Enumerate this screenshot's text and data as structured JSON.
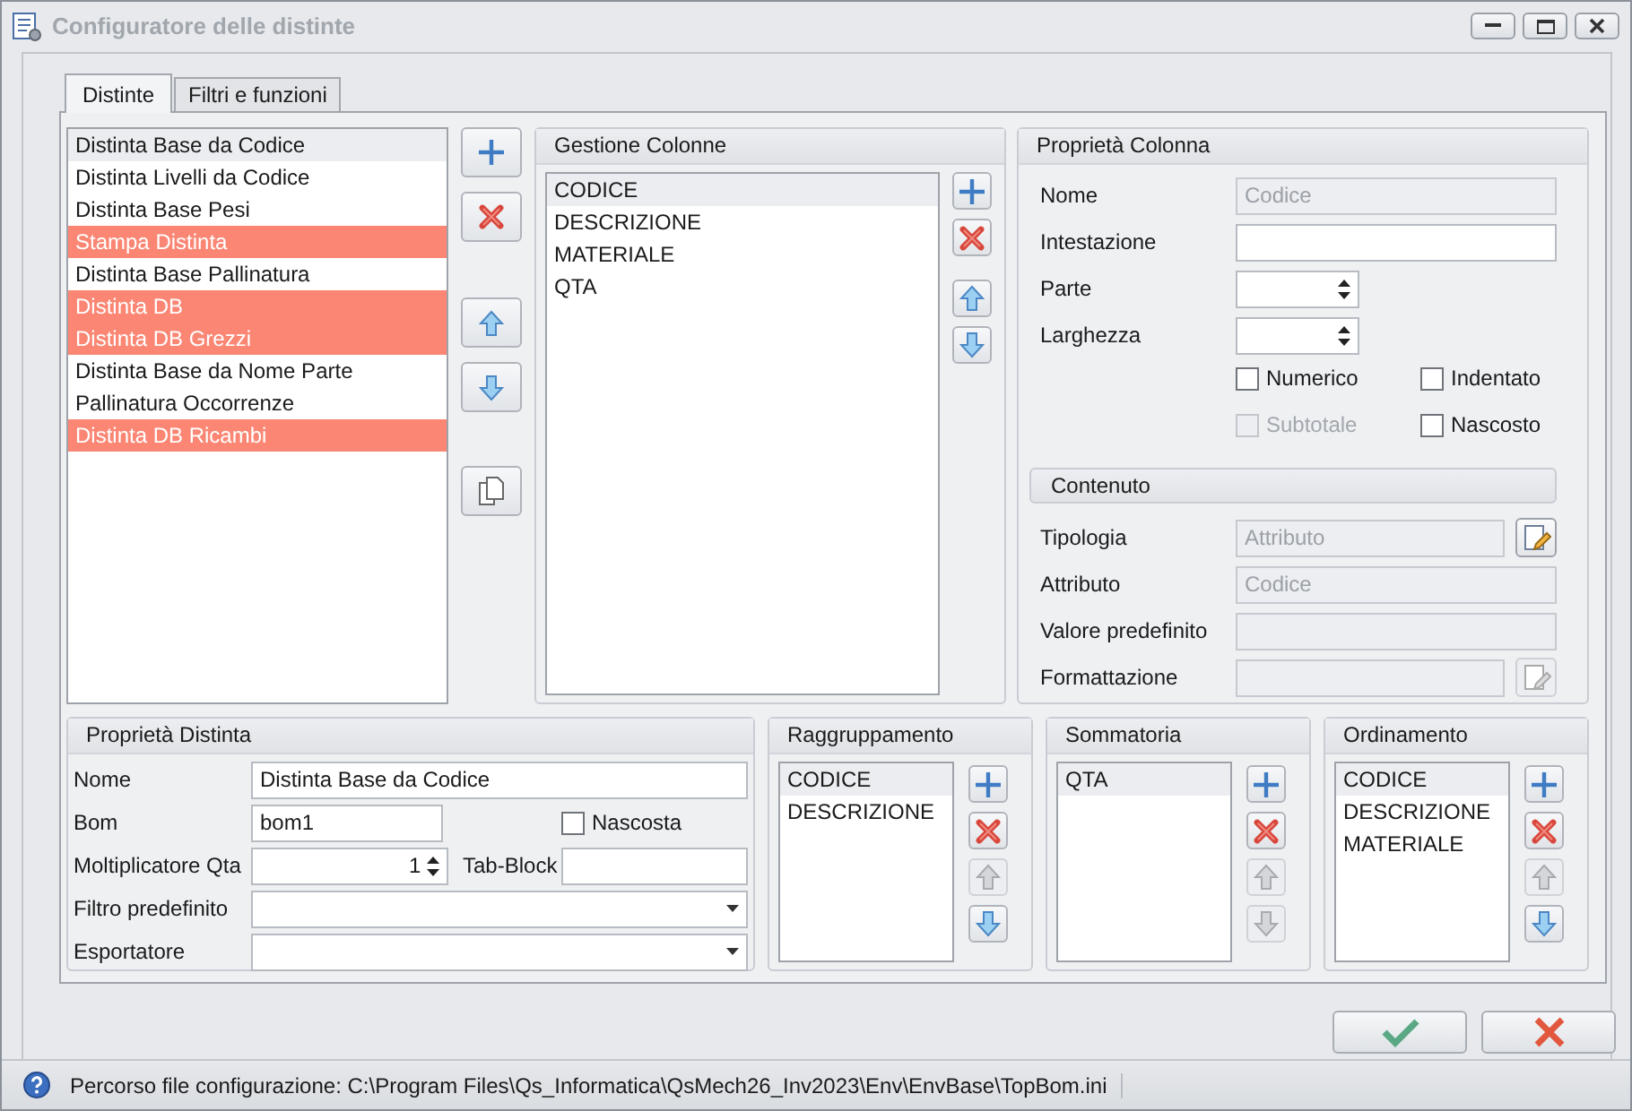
{
  "window": {
    "title": "Configuratore delle distinte"
  },
  "tabs": [
    {
      "label": "Distinte",
      "selected": true
    },
    {
      "label": "Filtri e funzioni",
      "selected": false
    }
  ],
  "distinte": {
    "items": [
      {
        "label": "Distinta Base da Codice",
        "selected": true,
        "highlighted": false
      },
      {
        "label": "Distinta Livelli da Codice",
        "selected": false,
        "highlighted": false
      },
      {
        "label": "Distinta Base Pesi",
        "selected": false,
        "highlighted": false
      },
      {
        "label": "Stampa Distinta",
        "selected": false,
        "highlighted": true
      },
      {
        "label": "Distinta Base Pallinatura",
        "selected": false,
        "highlighted": false
      },
      {
        "label": "Distinta DB",
        "selected": false,
        "highlighted": true
      },
      {
        "label": "Distinta DB Grezzi",
        "selected": false,
        "highlighted": true
      },
      {
        "label": "Distinta Base da Nome Parte",
        "selected": false,
        "highlighted": false
      },
      {
        "label": "Pallinatura Occorrenze",
        "selected": false,
        "highlighted": false
      },
      {
        "label": "Distinta DB Ricambi",
        "selected": false,
        "highlighted": true
      }
    ],
    "buttons": [
      {
        "kind": "add",
        "disabled": false
      },
      {
        "kind": "remove",
        "disabled": false
      },
      {
        "kind": "up",
        "disabled": false
      },
      {
        "kind": "down",
        "disabled": false
      },
      {
        "kind": "copy",
        "disabled": false
      }
    ]
  },
  "gestione_colonne": {
    "title": "Gestione Colonne",
    "items": [
      {
        "label": "CODICE",
        "selected": true
      },
      {
        "label": "DESCRIZIONE",
        "selected": false
      },
      {
        "label": "MATERIALE",
        "selected": false
      },
      {
        "label": "QTA",
        "selected": false
      }
    ],
    "buttons": [
      {
        "kind": "add",
        "disabled": false
      },
      {
        "kind": "remove",
        "disabled": false
      },
      {
        "kind": "up",
        "disabled": false
      },
      {
        "kind": "down",
        "disabled": false
      }
    ]
  },
  "proprieta_colonna": {
    "title": "Proprietà Colonna",
    "fields": [
      {
        "kind": "text",
        "label": "Nome",
        "value": "Codice",
        "disabled": true
      },
      {
        "kind": "text",
        "label": "Intestazione",
        "disabled": false
      },
      {
        "kind": "spin",
        "label": "Parte",
        "disabled": false
      },
      {
        "kind": "spin",
        "label": "Larghezza",
        "disabled": false
      }
    ],
    "checkboxes": [
      {
        "label": "Numerico",
        "checked": false,
        "disabled": false
      },
      {
        "label": "Indentato",
        "checked": false,
        "disabled": false
      },
      {
        "label": "Subtotale",
        "checked": false,
        "disabled": true
      },
      {
        "label": "Nascosto",
        "checked": false,
        "disabled": false
      }
    ],
    "contenuto": {
      "title": "Contenuto",
      "fields": [
        {
          "kind": "edit",
          "label": "Tipologia",
          "value": "Attributo",
          "disabled": true,
          "button_disabled": false
        },
        {
          "kind": "text",
          "label": "Attributo",
          "value": "Codice",
          "disabled": true
        },
        {
          "kind": "text",
          "label": "Valore predefinito",
          "disabled": true
        },
        {
          "kind": "edit",
          "label": "Formattazione",
          "disabled": true,
          "button_disabled": true
        }
      ]
    }
  },
  "proprieta_distinta": {
    "title": "Proprietà Distinta",
    "rows": [
      [
        {
          "kind": "text",
          "label": "Nome",
          "value": "Distinta Base da Codice"
        }
      ],
      [
        {
          "kind": "text",
          "label": "Bom",
          "value": "bom1"
        },
        {
          "kind": "checkbox",
          "label": "Nascosta",
          "checked": false
        }
      ],
      [
        {
          "kind": "spin",
          "label": "Moltiplicatore Qta",
          "value": "1"
        },
        {
          "kind": "text",
          "label": "Tab-Block"
        }
      ],
      [
        {
          "kind": "dropdown",
          "label": "Filtro predefinito"
        }
      ],
      [
        {
          "kind": "dropdown",
          "label": "Esportatore"
        }
      ]
    ]
  },
  "groups": [
    {
      "title": "Raggruppamento",
      "items": [
        {
          "label": "CODICE",
          "selected": true
        },
        {
          "label": "DESCRIZIONE",
          "selected": false
        }
      ],
      "buttons": [
        {
          "kind": "add",
          "disabled": false
        },
        {
          "kind": "remove",
          "disabled": false
        },
        {
          "kind": "up",
          "disabled": true
        },
        {
          "kind": "down",
          "disabled": false
        }
      ]
    },
    {
      "title": "Sommatoria",
      "items": [
        {
          "label": "QTA",
          "selected": true
        }
      ],
      "buttons": [
        {
          "kind": "add",
          "disabled": false
        },
        {
          "kind": "remove",
          "disabled": false
        },
        {
          "kind": "up",
          "disabled": true
        },
        {
          "kind": "down",
          "disabled": true
        }
      ]
    },
    {
      "title": "Ordinamento",
      "items": [
        {
          "label": "CODICE",
          "selected": true
        },
        {
          "label": "DESCRIZIONE",
          "selected": false
        },
        {
          "label": "MATERIALE",
          "selected": false
        }
      ],
      "buttons": [
        {
          "kind": "add",
          "disabled": false
        },
        {
          "kind": "remove",
          "disabled": false
        },
        {
          "kind": "up",
          "disabled": true
        },
        {
          "kind": "down",
          "disabled": false
        }
      ]
    }
  ],
  "footer": {
    "buttons": [
      {
        "kind": "ok"
      },
      {
        "kind": "cancel"
      }
    ]
  },
  "status_bar": {
    "text": "Percorso file configurazione: C:\\Program Files\\Qs_Informatica\\QsMech26_Inv2023\\Env\\EnvBase\\TopBom.ini"
  }
}
